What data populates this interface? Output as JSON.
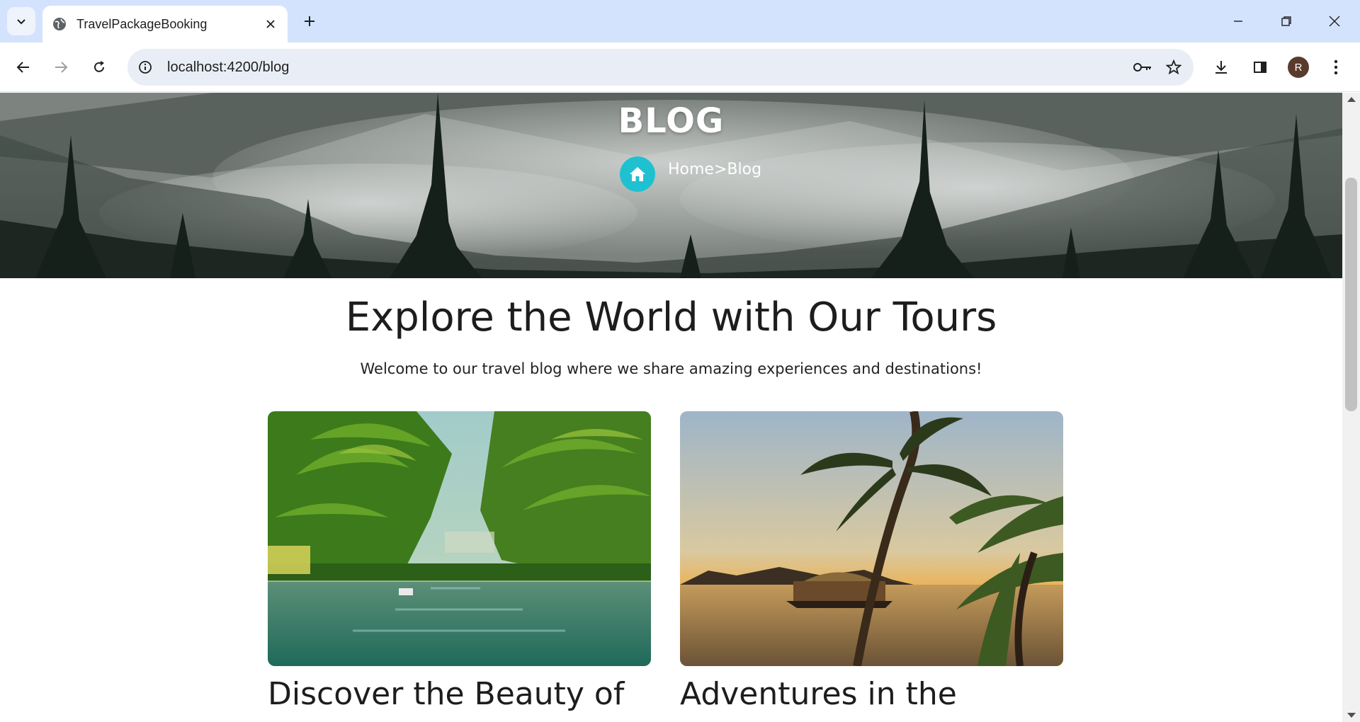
{
  "browser": {
    "tab_title": "TravelPackageBooking",
    "url": "localhost:4200/blog",
    "profile_initial": "R"
  },
  "hero": {
    "title": "BLOG",
    "breadcrumb": "Home>Blog"
  },
  "intro": {
    "heading": "Explore the World with Our Tours",
    "subheading": "Welcome to our travel blog where we share amazing experiences and destinations!"
  },
  "cards": [
    {
      "title": "Discover the Beauty of"
    },
    {
      "title": "Adventures in the"
    }
  ],
  "colors": {
    "accent": "#1fc1d1",
    "chrome_bg": "#d3e3fd",
    "omnibox_bg": "#e9eef6"
  }
}
